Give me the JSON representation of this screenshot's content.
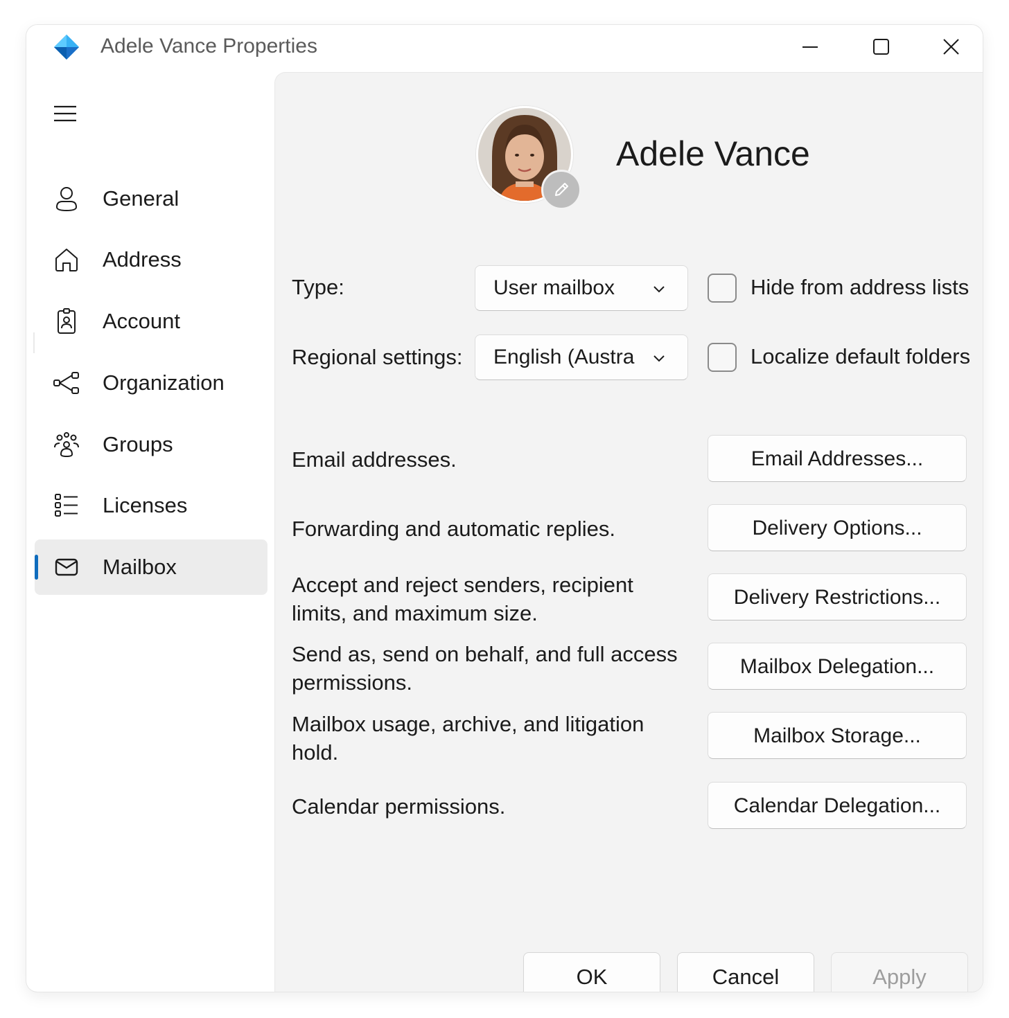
{
  "window": {
    "title": "Adele Vance Properties",
    "controls": {
      "minimize_icon": "minimize-icon",
      "maximize_icon": "maximize-icon",
      "close_icon": "close-icon"
    }
  },
  "sidebar": {
    "menu_icon": "hamburger-icon",
    "items": [
      {
        "label": "General",
        "icon": "person-icon",
        "active": false
      },
      {
        "label": "Address",
        "icon": "home-icon",
        "active": false
      },
      {
        "label": "Account",
        "icon": "id-badge-icon",
        "active": false
      },
      {
        "label": "Organization",
        "icon": "org-chart-icon",
        "active": false
      },
      {
        "label": "Groups",
        "icon": "people-group-icon",
        "active": false
      },
      {
        "label": "Licenses",
        "icon": "list-icon",
        "active": false
      },
      {
        "label": "Mailbox",
        "icon": "mail-icon",
        "active": true
      }
    ],
    "accent_color": "#0f6cbd"
  },
  "profile": {
    "display_name": "Adele Vance",
    "edit_icon": "pencil-icon"
  },
  "fields": {
    "type": {
      "label": "Type:",
      "value": "User mailbox"
    },
    "regional": {
      "label": "Regional settings:",
      "value": "English (Austra"
    },
    "hide_from_lists": {
      "label": "Hide from address lists",
      "checked": false
    },
    "localize_folders": {
      "label": "Localize default folders",
      "checked": false
    }
  },
  "actions": [
    {
      "description": "Email addresses.",
      "button": "Email Addresses..."
    },
    {
      "description": "Forwarding and automatic replies.",
      "button": "Delivery Options..."
    },
    {
      "description": "Accept and reject senders, recipient limits, and maximum size.",
      "button": "Delivery Restrictions..."
    },
    {
      "description": "Send as, send on behalf, and full access permissions.",
      "button": "Mailbox Delegation..."
    },
    {
      "description": "Mailbox usage, archive, and litigation hold.",
      "button": "Mailbox Storage..."
    },
    {
      "description": "Calendar permissions.",
      "button": "Calendar Delegation..."
    }
  ],
  "footer": {
    "ok": "OK",
    "cancel": "Cancel",
    "apply": "Apply",
    "apply_enabled": false
  }
}
